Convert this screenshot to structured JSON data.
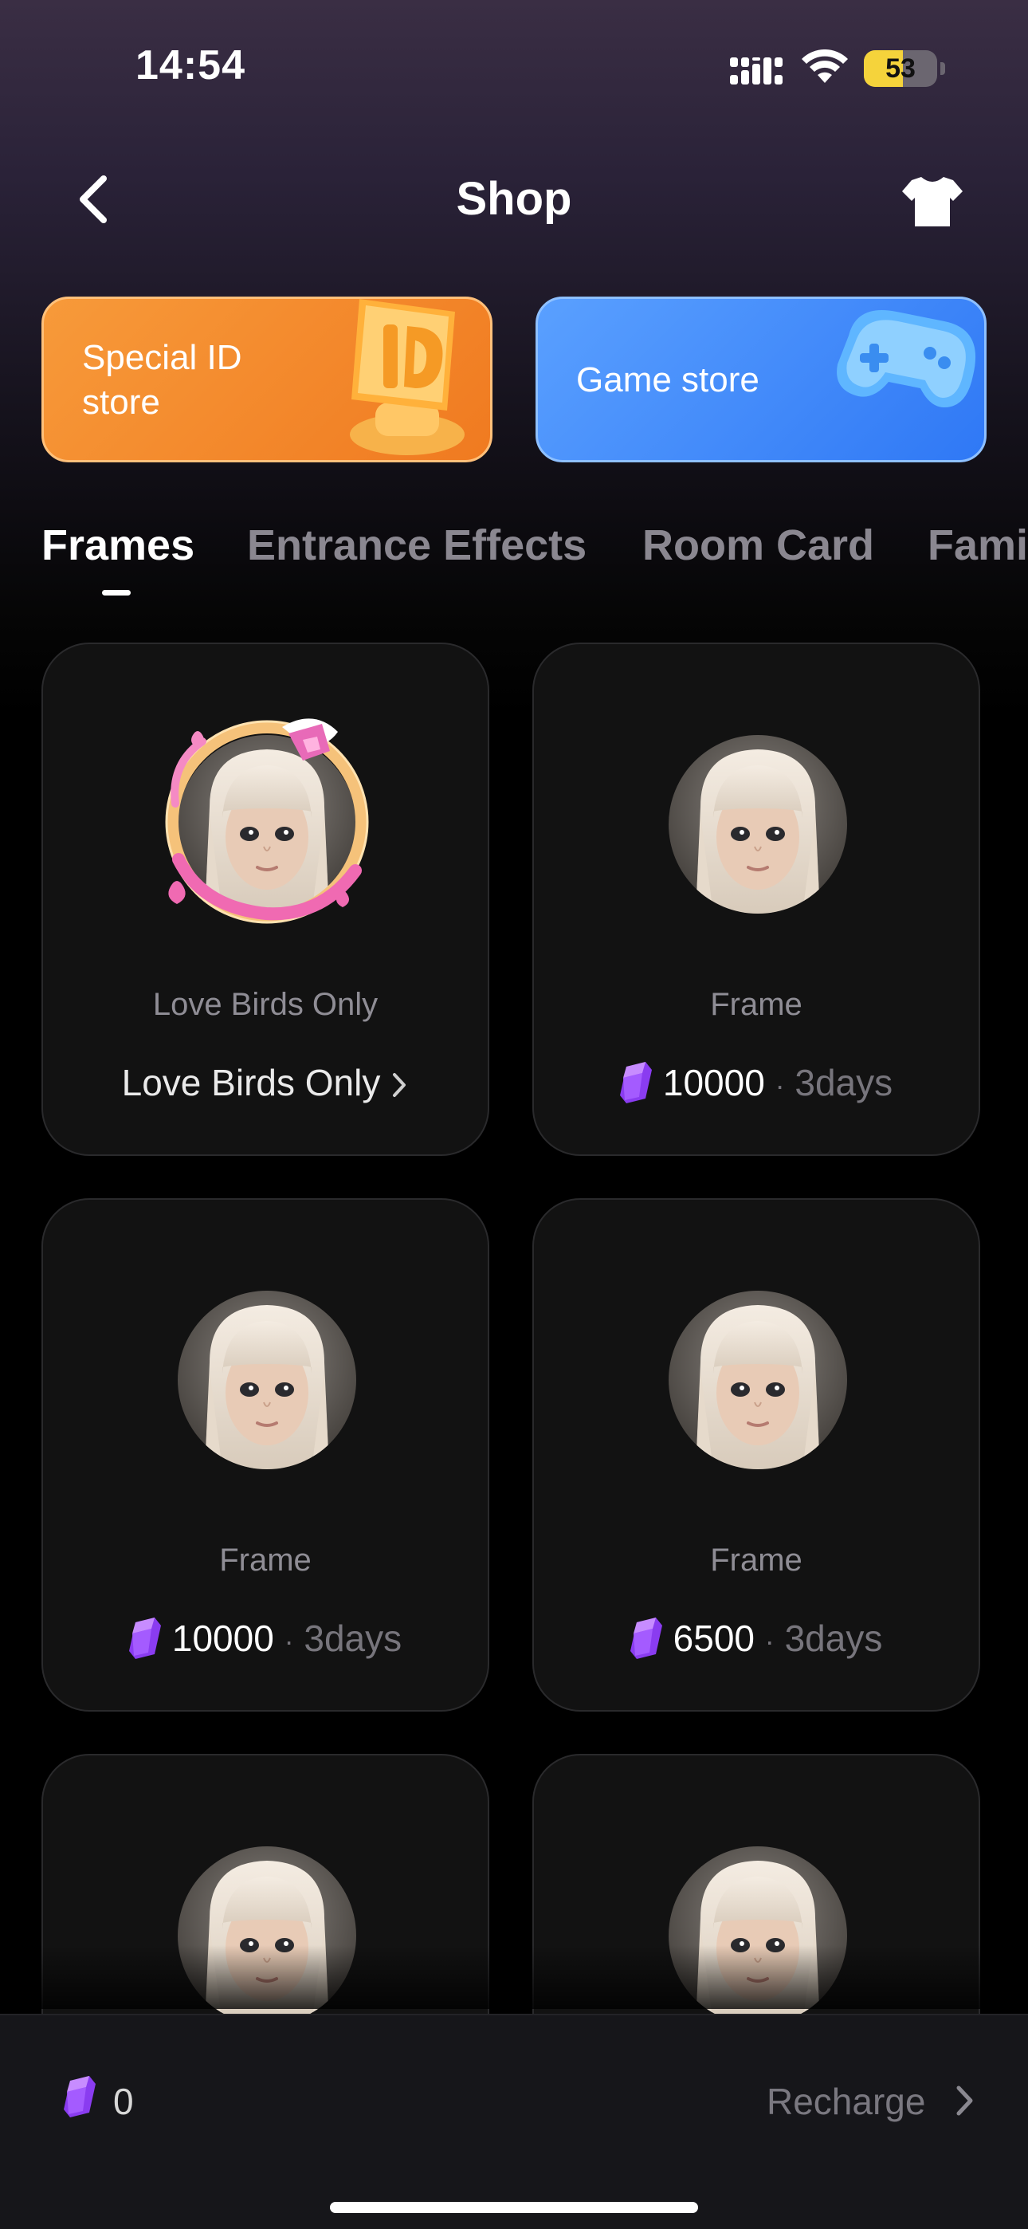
{
  "status_bar": {
    "time": "14:54",
    "battery_percent": "53",
    "battery_level": 0.53
  },
  "header": {
    "title": "Shop",
    "back_icon": "chevron-left-icon",
    "outfit_icon": "tshirt-icon"
  },
  "banners": {
    "special": {
      "label": "Special ID store",
      "color": "#f07a20"
    },
    "game": {
      "label": "Game store",
      "color": "#2f78f5"
    }
  },
  "tabs": [
    "Frames",
    "Entrance Effects",
    "Room Card",
    "Family"
  ],
  "active_tab": "Frames",
  "items": [
    {
      "name": "Love Birds Only",
      "link_label": "Love Birds Only"
    },
    {
      "name": "Frame",
      "price": "10000",
      "separator": "·",
      "duration": "3days"
    },
    {
      "name": "Frame",
      "price": "10000",
      "separator": "·",
      "duration": "3days"
    },
    {
      "name": "Frame",
      "price": "6500",
      "separator": "·",
      "duration": "3days"
    }
  ],
  "footer": {
    "balance": "0",
    "recharge_label": "Recharge"
  },
  "colors": {
    "accent_gem": "#9b4dff",
    "background": "#000000",
    "card": "#121212"
  }
}
